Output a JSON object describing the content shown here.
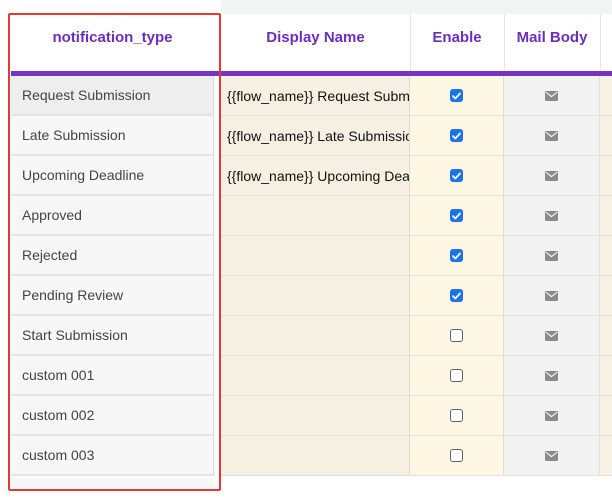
{
  "header": {
    "notification_type": "notification_type",
    "display_name": "Display Name",
    "enable": "Enable",
    "mail_body": "Mail Body"
  },
  "rows": [
    {
      "type": "Request Submission",
      "display": "{{flow_name}} Request Submission",
      "enabled": true
    },
    {
      "type": "Late Submission",
      "display": "{{flow_name}} Late Submission",
      "enabled": true
    },
    {
      "type": "Upcoming Deadline",
      "display": "{{flow_name}} Upcoming Deadline",
      "enabled": true
    },
    {
      "type": "Approved",
      "display": "",
      "enabled": true
    },
    {
      "type": "Rejected",
      "display": "",
      "enabled": true
    },
    {
      "type": "Pending Review",
      "display": "",
      "enabled": true
    },
    {
      "type": "Start Submission",
      "display": "",
      "enabled": false
    },
    {
      "type": "custom 001",
      "display": "",
      "enabled": false
    },
    {
      "type": "custom 002",
      "display": "",
      "enabled": false
    },
    {
      "type": "custom 003",
      "display": "",
      "enabled": false
    }
  ],
  "icons": {
    "mail": "envelope-icon",
    "check": "checkmark-icon"
  },
  "colors": {
    "header_text": "#6d2dbd",
    "accent_bar": "#7634c6",
    "checkbox_checked": "#1a73e8",
    "highlight_border": "#e53935"
  }
}
